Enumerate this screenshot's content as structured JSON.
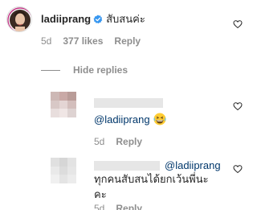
{
  "main_comment": {
    "username": "ladiiprang",
    "text": "สับสนค่ะ",
    "age": "5d",
    "likes": "377 likes",
    "reply_label": "Reply",
    "verified_icon": "verified-badge-icon",
    "like_icon": "heart-outline-icon"
  },
  "hide_replies_label": "Hide replies",
  "replies": [
    {
      "mention": "@ladiiprang",
      "emoji": "grinning-squinting-face-emoji",
      "age": "5d",
      "reply_label": "Reply",
      "like_icon": "heart-outline-icon"
    },
    {
      "mention": "@ladiiprang",
      "text_line1": "ทุกคนสับสนได้ยกเว้นพี่นะ",
      "text_line2": "คะ",
      "age": "5d",
      "reply_label": "Reply",
      "like_icon": "heart-outline-icon"
    }
  ],
  "colors": {
    "text": "#262626",
    "secondary": "#8e8e8e",
    "link": "#00376b",
    "verified": "#3897f0"
  }
}
